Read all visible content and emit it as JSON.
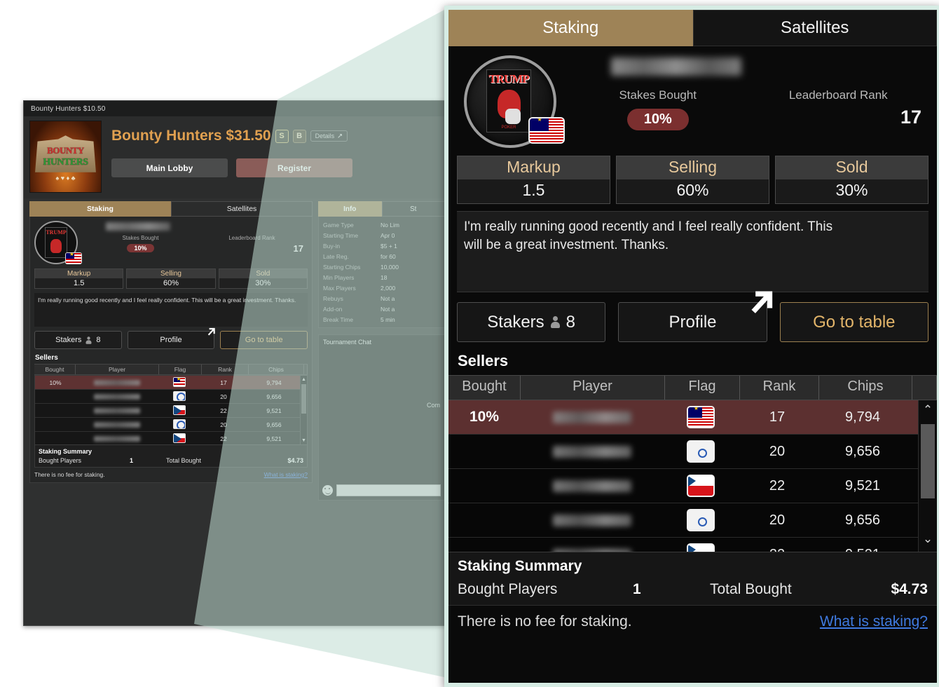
{
  "bg_window": {
    "titlebar": "Bounty Hunters $10.50",
    "tournament_title": "Bounty Hunters $31.50",
    "badge_s": "S",
    "badge_b": "B",
    "details_label": "Details",
    "buttons": {
      "main_lobby": "Main Lobby",
      "register": "Register"
    },
    "logo": {
      "word1": "BOUNTY",
      "word2": "HUNTERS",
      "suits": "♠ ♥ ♦ ♣"
    },
    "tabs": {
      "staking": "Staking",
      "satellites": "Satellites"
    },
    "right_tabs": {
      "info": "Info",
      "standings": "St"
    },
    "info_rows": [
      {
        "key": "Game Type",
        "value": "No Lim"
      },
      {
        "key": "Starting Time",
        "value": "Apr 0"
      },
      {
        "key": "Buy-in",
        "value": "$5 + 1"
      },
      {
        "key": "Late Reg.",
        "value": "for 60"
      },
      {
        "key": "Starting Chips",
        "value": "10,000"
      },
      {
        "key": "Min Players",
        "value": "18"
      },
      {
        "key": "Max Players",
        "value": "2,000"
      },
      {
        "key": "Rebuys",
        "value": "Not a"
      },
      {
        "key": "Add-on",
        "value": "Not a"
      },
      {
        "key": "Break Time",
        "value": "5 min"
      }
    ],
    "chat": {
      "title": "Tournament Chat",
      "partial_message": "Com"
    }
  },
  "zoom_panel": {
    "tabs": [
      {
        "label": "Staking",
        "active": true
      },
      {
        "label": "Satellites",
        "active": false
      }
    ],
    "player": {
      "name_redacted": "",
      "flag": "malaysia-flag",
      "avatar": "trump-playing-card-avatar",
      "avatar_card_text": "TRUMP"
    },
    "stats": {
      "stakes_bought_label": "Stakes Bought",
      "stakes_bought_value": "10%",
      "leaderboard_rank_label": "Leaderboard Rank",
      "leaderboard_rank_value": "17"
    },
    "metrics": [
      {
        "label": "Markup",
        "value": "1.5"
      },
      {
        "label": "Selling",
        "value": "60%"
      },
      {
        "label": "Sold",
        "value": "30%"
      }
    ],
    "note": "I'm really running good recently and I feel really confident.  This will be a great investment. Thanks.",
    "actions": {
      "stakers_label": "Stakers",
      "stakers_count": "8",
      "profile_label": "Profile",
      "go_to_table_label": "Go to table"
    },
    "sellers": {
      "heading": "Sellers",
      "columns": [
        "Bought",
        "Player",
        "Flag",
        "Rank",
        "Chips",
        ""
      ],
      "rows": [
        {
          "bought": "10%",
          "player": "",
          "flag": "malaysia-flag",
          "rank": "17",
          "chips": "9,794",
          "selected": true
        },
        {
          "bought": "",
          "player": "",
          "flag": "white-emblem-flag",
          "rank": "20",
          "chips": "9,656",
          "selected": false
        },
        {
          "bought": "",
          "player": "",
          "flag": "czech-flag",
          "rank": "22",
          "chips": "9,521",
          "selected": false
        },
        {
          "bought": "",
          "player": "",
          "flag": "white-emblem-flag",
          "rank": "20",
          "chips": "9,656",
          "selected": false
        },
        {
          "bought": "",
          "player": "",
          "flag": "czech-flag",
          "rank": "22",
          "chips": "9,521",
          "selected": false
        }
      ]
    },
    "summary": {
      "heading": "Staking Summary",
      "bought_players_label": "Bought Players",
      "bought_players_value": "1",
      "total_bought_label": "Total Bought",
      "total_bought_value": "$4.73"
    },
    "footer": {
      "fee_text": "There is no fee for staking.",
      "link_text": "What is staking?"
    }
  },
  "colors": {
    "accent_tan": "#9e8357",
    "highlight_row": "#5c3030",
    "link_blue": "#3f7ae0",
    "gold_text": "#e3b56a",
    "cone_mint": "#d6ece4"
  }
}
